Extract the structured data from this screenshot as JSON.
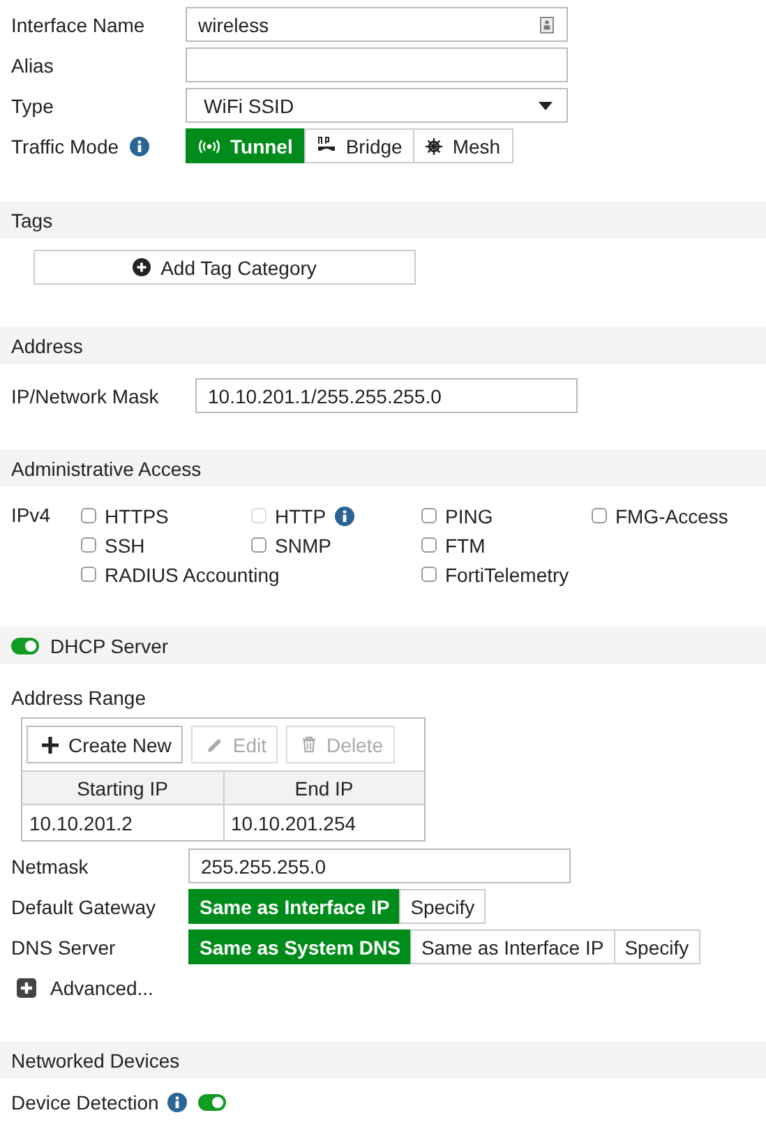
{
  "general": {
    "fields": [
      {
        "kind": "text",
        "label": "Interface Name",
        "value": "wireless"
      },
      {
        "kind": "text",
        "label": "Alias"
      },
      {
        "kind": "select",
        "label": "Type",
        "value": "WiFi SSID"
      }
    ],
    "traffic_mode": {
      "label": "Traffic Mode",
      "options": [
        {
          "kind": "tunnel",
          "label": "Tunnel",
          "selected": true
        },
        {
          "kind": "bridge",
          "label": "Bridge",
          "selected": false
        },
        {
          "kind": "mesh",
          "label": "Mesh",
          "selected": false
        }
      ]
    }
  },
  "tags": {
    "title": "Tags",
    "button": "Add Tag Category"
  },
  "address": {
    "title": "Address",
    "label": "IP/Network Mask",
    "value": "10.10.201.1/255.255.255.0"
  },
  "admin_access": {
    "title": "Administrative Access",
    "label": "IPv4",
    "rows": [
      [
        {
          "label": "HTTPS",
          "checked": false,
          "disabled": false
        },
        {
          "label": "HTTP",
          "checked": false,
          "disabled": true,
          "info": true
        },
        {
          "label": "PING",
          "checked": false,
          "disabled": false
        },
        {
          "label": "FMG-Access",
          "checked": false,
          "disabled": false
        }
      ],
      [
        {
          "label": "SSH",
          "checked": false,
          "disabled": false
        },
        {
          "label": "SNMP",
          "checked": false,
          "disabled": false
        },
        {
          "label": "FTM",
          "checked": false,
          "disabled": false
        }
      ],
      [
        {
          "label": "RADIUS Accounting",
          "checked": false,
          "disabled": false
        },
        "",
        {
          "label": "FortiTelemetry",
          "checked": false,
          "disabled": false
        }
      ]
    ]
  },
  "dhcp": {
    "title": "DHCP Server",
    "on": true,
    "range_label": "Address Range",
    "toolbar": [
      {
        "kind": "create",
        "label": "Create New",
        "disabled": false
      },
      {
        "kind": "edit",
        "label": "Edit",
        "disabled": true
      },
      {
        "kind": "delete",
        "label": "Delete",
        "disabled": true
      }
    ],
    "columns": [
      "Starting IP",
      "End IP"
    ],
    "rows": [
      [
        "10.10.201.2",
        "10.10.201.254"
      ]
    ],
    "netmask": {
      "label": "Netmask",
      "value": "255.255.255.0"
    },
    "choices": [
      {
        "label": "Default Gateway",
        "options": [
          {
            "label": "Same as Interface IP",
            "selected": true
          },
          {
            "label": "Specify",
            "selected": false
          }
        ]
      },
      {
        "label": "DNS Server",
        "options": [
          {
            "label": "Same as System DNS",
            "selected": true
          },
          {
            "label": "Same as Interface IP",
            "selected": false
          },
          {
            "label": "Specify",
            "selected": false
          }
        ]
      }
    ],
    "advanced": "Advanced..."
  },
  "networked_devices": {
    "title": "Networked Devices",
    "detection": {
      "label": "Device Detection",
      "on": true
    }
  }
}
